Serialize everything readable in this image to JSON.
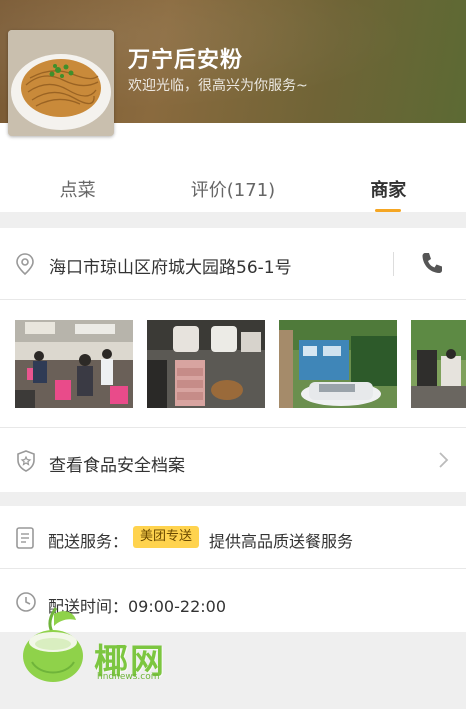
{
  "shop": {
    "name": "万宁后安粉",
    "welcome": "欢迎光临，很高兴为你服务~"
  },
  "tabs": [
    {
      "label": "点菜",
      "active": false
    },
    {
      "label": "评价(171)",
      "active": false
    },
    {
      "label": "商家",
      "active": true
    }
  ],
  "address": {
    "text": "海口市琼山区府城大园路56-1号",
    "icon": "location-pin-icon",
    "phone_icon": "phone-icon"
  },
  "photos": [
    {
      "name": "restaurant-interior-photo"
    },
    {
      "name": "kitchen-photo"
    },
    {
      "name": "storefront-photo"
    },
    {
      "name": "street-photo"
    }
  ],
  "safety": {
    "label": "查看食品安全档案",
    "icon": "shield-icon"
  },
  "delivery": {
    "label": "配送服务：",
    "badge": "美团专送",
    "desc": "提供高品质送餐服务",
    "time": "配送时间：09:00-22:00"
  },
  "watermark": {
    "text": "椰网",
    "url": "hndnews.com"
  },
  "colors": {
    "accent": "#f5a623",
    "badge": "#ffd34e",
    "gray_bg": "#efefef"
  }
}
